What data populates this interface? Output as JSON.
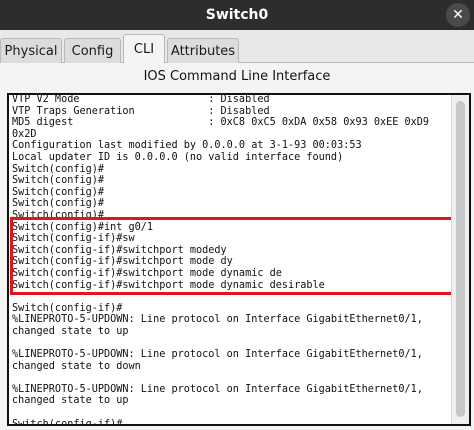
{
  "window": {
    "title": "Switch0",
    "close_label": "✕"
  },
  "tabs": [
    {
      "label": "Physical",
      "active": false
    },
    {
      "label": "Config",
      "active": false
    },
    {
      "label": "CLI",
      "active": true
    },
    {
      "label": "Attributes",
      "active": false
    }
  ],
  "panel": {
    "heading": "IOS Command Line Interface"
  },
  "terminal": {
    "lines": [
      "VTP V2 Mode                     : Disabled",
      "VTP Traps Generation            : Disabled",
      "MD5 digest                      : 0xC8 0xC5 0xDA 0x58 0x93 0xEE 0xD9",
      "0x2D",
      "Configuration last modified by 0.0.0.0 at 3-1-93 00:03:53",
      "Local updater ID is 0.0.0.0 (no valid interface found)",
      "Switch(config)#",
      "Switch(config)#",
      "Switch(config)#",
      "Switch(config)#",
      "Switch(config)#",
      "Switch(config)#int g0/1",
      "Switch(config-if)#sw",
      "Switch(config-if)#switchport modedy",
      "Switch(config-if)#switchport mode dy",
      "Switch(config-if)#switchport mode dynamic de",
      "Switch(config-if)#switchport mode dynamic desirable",
      "",
      "Switch(config-if)#",
      "%LINEPROTO-5-UPDOWN: Line protocol on Interface GigabitEthernet0/1,",
      "changed state to up",
      "",
      "%LINEPROTO-5-UPDOWN: Line protocol on Interface GigabitEthernet0/1,",
      "changed state to down",
      "",
      "%LINEPROTO-5-UPDOWN: Line protocol on Interface GigabitEthernet0/1,",
      "changed state to up",
      "",
      "Switch(config-if)#"
    ]
  },
  "colors": {
    "highlight": "#e0161b",
    "titlebar": "#2d2d2d"
  }
}
